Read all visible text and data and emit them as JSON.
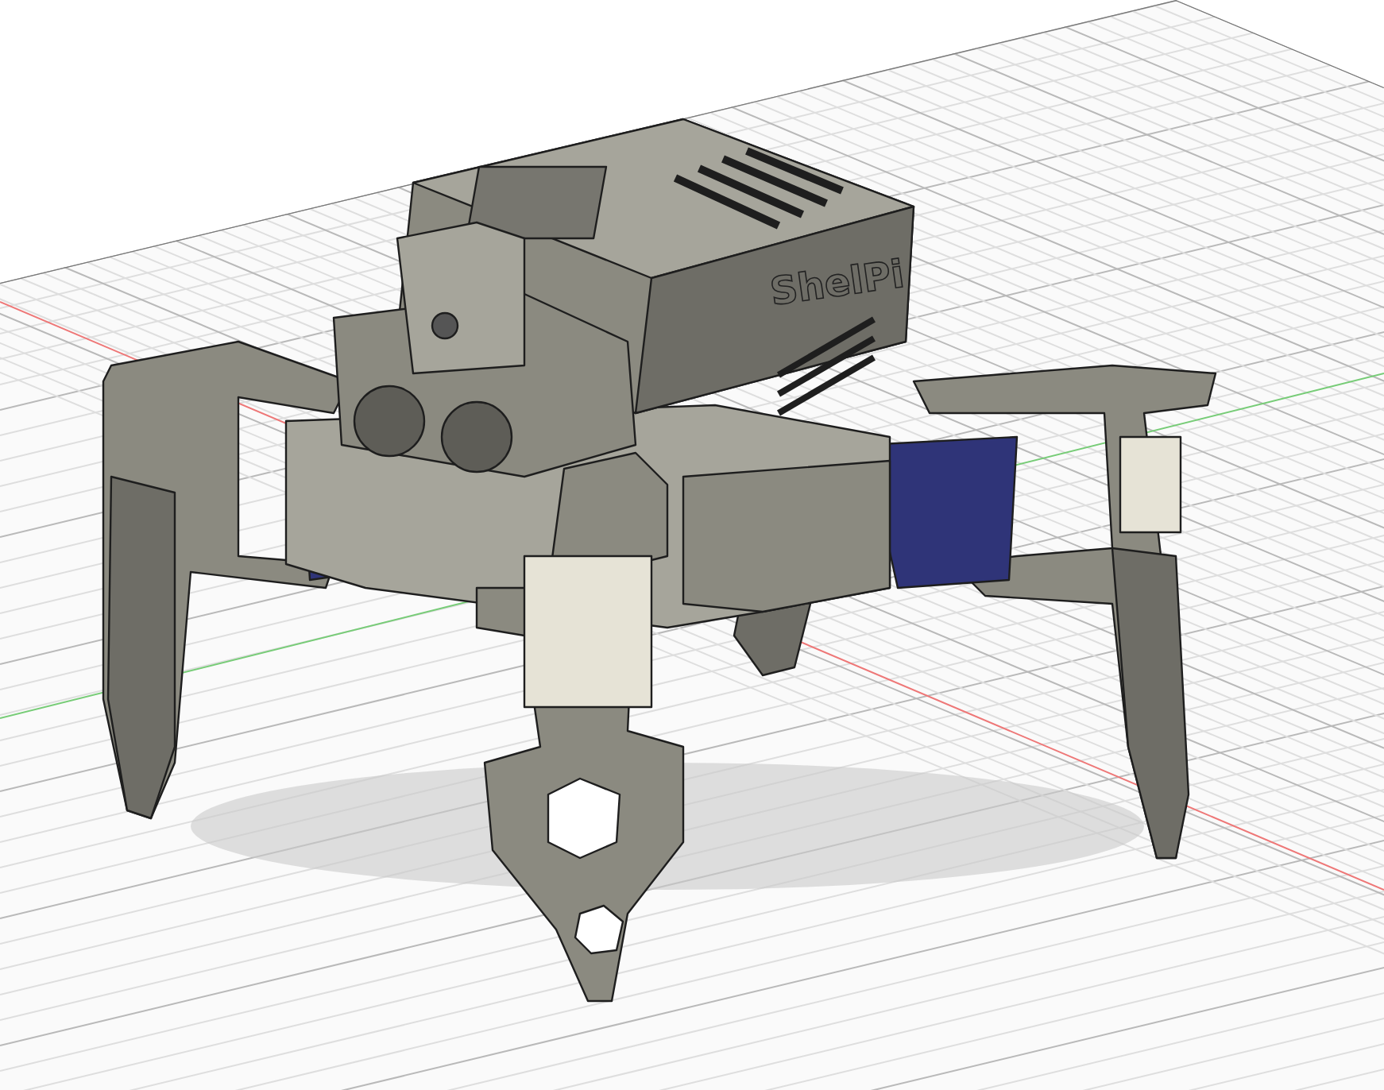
{
  "viewport": {
    "model": {
      "label": "ShelPi"
    }
  }
}
